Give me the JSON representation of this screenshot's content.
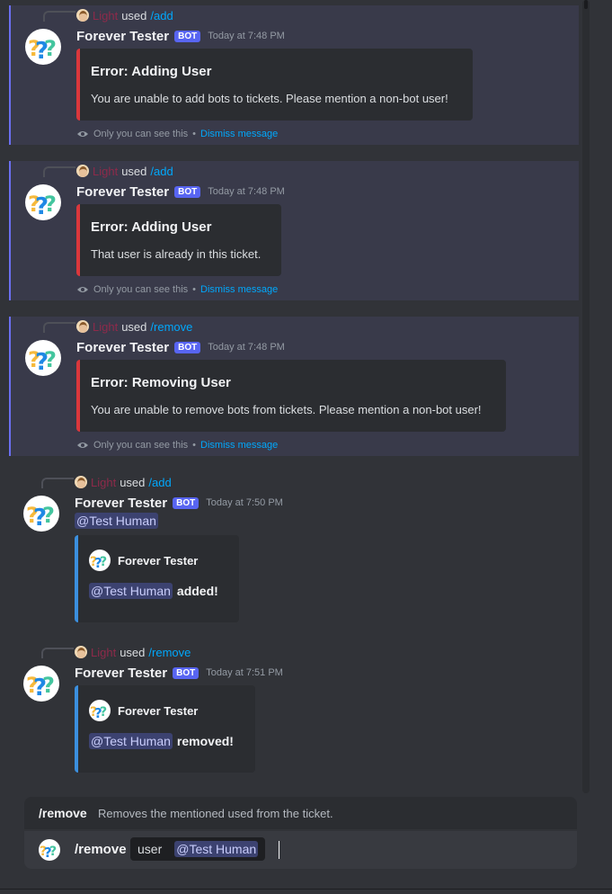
{
  "bot": {
    "name": "Forever Tester",
    "tag": "BOT"
  },
  "reply_user": "Light",
  "used_word": "used",
  "ephemeral": {
    "only_you": "Only you can see this",
    "separator": "•",
    "dismiss": "Dismiss message"
  },
  "messages": [
    {
      "command": "/add",
      "time": "Today at 7:48 PM",
      "title": "Error: Adding User",
      "desc": "You are unable to add bots to tickets. Please mention a non-bot user!"
    },
    {
      "command": "/add",
      "time": "Today at 7:48 PM",
      "title": "Error: Adding User",
      "desc": "That user is already in this ticket."
    },
    {
      "command": "/remove",
      "time": "Today at 7:48 PM",
      "title": "Error: Removing User",
      "desc": "You are unable to remove bots from tickets. Please mention a non-bot user!"
    },
    {
      "command": "/add",
      "time": "Today at 7:50 PM",
      "mention": "@Test Human",
      "embed_author": "Forever Tester",
      "embed_mention": "@Test Human",
      "embed_action": "added!"
    },
    {
      "command": "/remove",
      "time": "Today at 7:51 PM",
      "embed_author": "Forever Tester",
      "embed_mention": "@Test Human",
      "embed_action": "removed!"
    }
  ],
  "command_hint": {
    "name": "/remove",
    "description": "Removes the mentioned used from the ticket."
  },
  "composer": {
    "command": "/remove",
    "option_name": "user",
    "option_value": "@Test Human"
  },
  "colors": {
    "blurple": "#5865f2",
    "error_bar": "#da373c",
    "success_bar": "#3b8fde",
    "link": "#00a8fc",
    "mention_bg": "#3c4270"
  }
}
